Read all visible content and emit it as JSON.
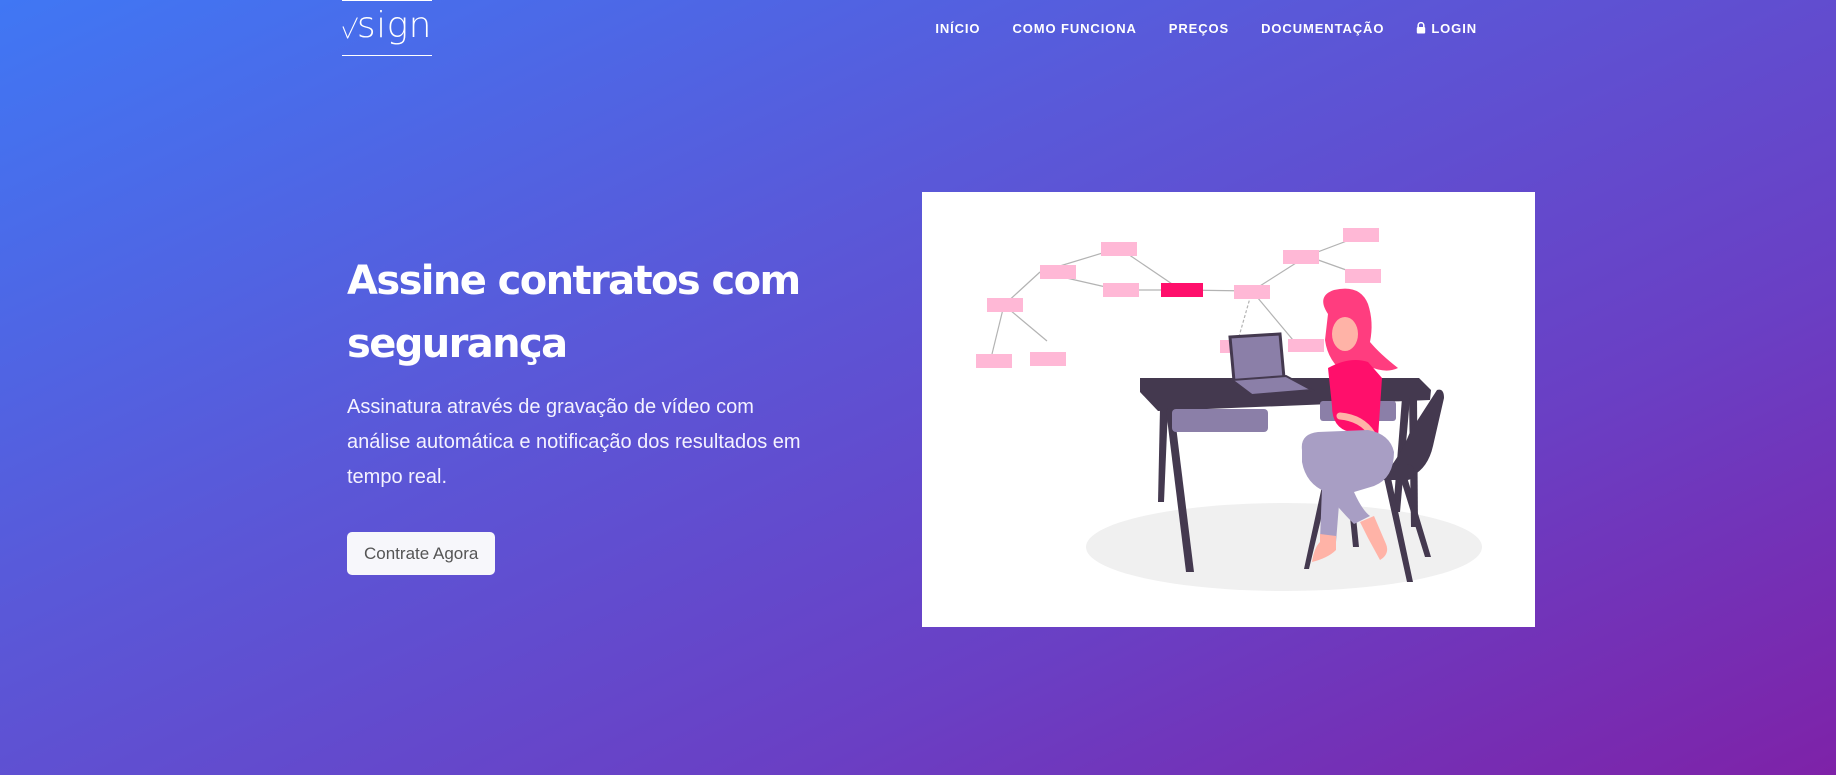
{
  "brand": {
    "name": "sign"
  },
  "nav": {
    "items": [
      {
        "label": "INÍCIO"
      },
      {
        "label": "COMO FUNCIONA"
      },
      {
        "label": "PREÇOS"
      },
      {
        "label": "DOCUMENTAÇÃO"
      },
      {
        "label": "LOGIN",
        "icon": "lock-icon"
      }
    ]
  },
  "hero": {
    "title": "Assine contratos com segurança",
    "subtitle": "Assinatura através de gravação de vídeo com análise automática e notificação dos resultados em tempo real.",
    "cta_label": "Contrate Agora"
  },
  "colors": {
    "gradient_start": "#4077f4",
    "gradient_end": "#7e22a8",
    "accent_pink": "#ff0f6b",
    "node_pink": "#ffb8d6"
  }
}
